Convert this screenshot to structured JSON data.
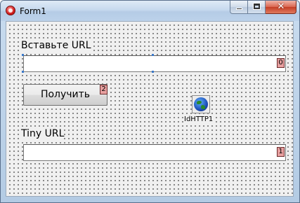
{
  "window": {
    "title": "Form1",
    "close_glyph": "✕",
    "icons": {
      "app": "delphi-app-icon",
      "minimize": "minimize-icon",
      "maximize": "maximize-icon",
      "close": "close-icon"
    }
  },
  "form": {
    "url_label": "Вставьте URL",
    "url_input_value": "",
    "url_input_tab_order": "0",
    "get_button_label": "Получить",
    "get_button_tab_order": "2",
    "tiny_label": "Tiny URL",
    "tiny_input_value": "",
    "tiny_input_tab_order": "1",
    "component_name": "IdHTTP1",
    "component_icon": "globe-icon"
  }
}
